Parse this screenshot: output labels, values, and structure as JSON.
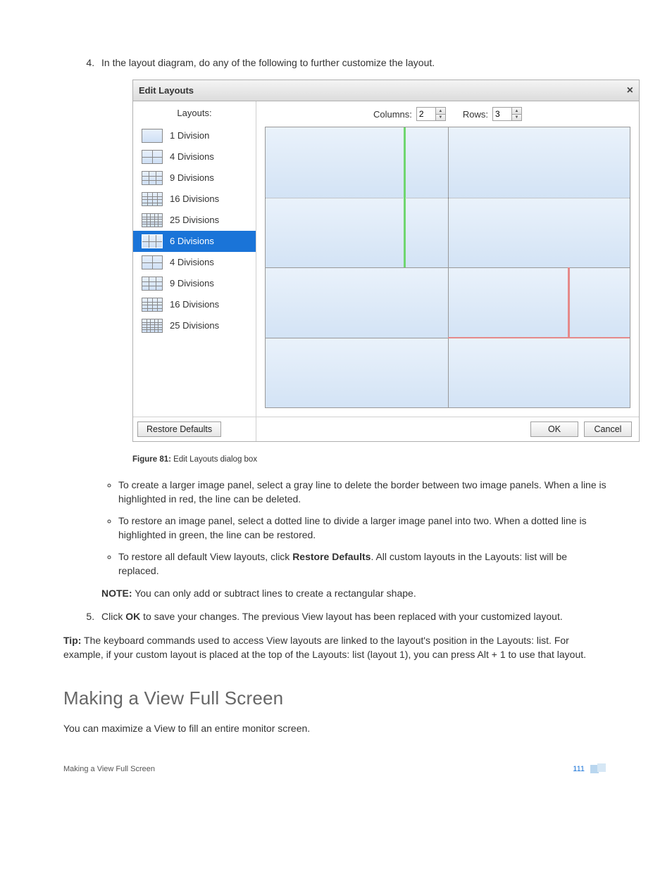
{
  "step4": {
    "num": "4.",
    "text": "In the layout diagram, do any of the following to further customize the layout."
  },
  "dialog": {
    "title": "Edit Layouts",
    "close": "×",
    "layouts_label": "Layouts:",
    "columns_label": "Columns:",
    "columns_value": "2",
    "rows_label": "Rows:",
    "rows_value": "3",
    "restore": "Restore Defaults",
    "ok": "OK",
    "cancel": "Cancel",
    "items": [
      {
        "label": "1 Division",
        "cols": 1,
        "rows": 1,
        "selected": false
      },
      {
        "label": "4 Divisions",
        "cols": 2,
        "rows": 2,
        "selected": false
      },
      {
        "label": "9 Divisions",
        "cols": 3,
        "rows": 3,
        "selected": false
      },
      {
        "label": "16 Divisions",
        "cols": 4,
        "rows": 4,
        "selected": false
      },
      {
        "label": "25 Divisions",
        "cols": 5,
        "rows": 5,
        "selected": false
      },
      {
        "label": "6 Divisions",
        "cols": 3,
        "rows": 2,
        "selected": true
      },
      {
        "label": "4 Divisions",
        "cols": 2,
        "rows": 2,
        "selected": false
      },
      {
        "label": "9 Divisions",
        "cols": 3,
        "rows": 3,
        "selected": false
      },
      {
        "label": "16 Divisions",
        "cols": 4,
        "rows": 4,
        "selected": false
      },
      {
        "label": "25 Divisions",
        "cols": 5,
        "rows": 5,
        "selected": false
      }
    ]
  },
  "caption": {
    "label": "Figure 81:",
    "text": " Edit Layouts dialog box"
  },
  "bullets": {
    "b1a": "To create a larger image panel, select a gray line to delete the border between two image panels. When a line is highlighted in red, the line can be deleted.",
    "b2a": "To restore an image panel, select a dotted line to divide a larger image panel into two. When a dotted line is highlighted in green, the line can be restored.",
    "b3_pre": "To restore all default View layouts, click ",
    "b3_bold": "Restore Defaults",
    "b3_post": ". All custom layouts in the Layouts: list will be replaced."
  },
  "note": {
    "label": "NOTE:",
    "text": " You can only add or subtract lines to create a rectangular shape."
  },
  "step5": {
    "pre": "Click ",
    "bold": "OK",
    "post": " to save your changes. The previous View layout has been replaced with your customized layout."
  },
  "tip": {
    "label": "Tip:",
    "text": " The keyboard commands used to access View layouts are linked to the layout's position in the Layouts: list. For example, if your custom layout is placed at the top of the Layouts: list (layout 1), you can press Alt + 1 to use that layout."
  },
  "section_heading": "Making a View Full Screen",
  "section_para": "You can maximize a View to fill an entire monitor screen.",
  "footer": {
    "left": "Making a View Full Screen",
    "page": "111"
  }
}
